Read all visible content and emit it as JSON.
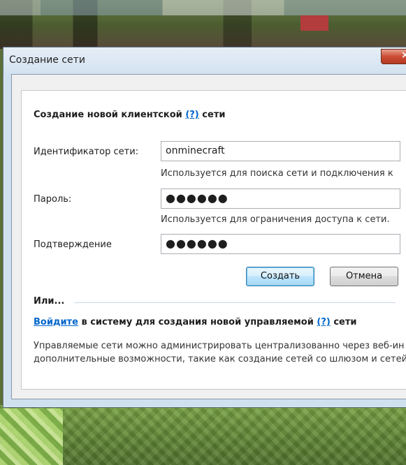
{
  "window": {
    "title": "Создание сети",
    "close_glyph": "×"
  },
  "form": {
    "heading_prefix": "Создание новой клиентской",
    "help_link": "(?)",
    "heading_suffix": "сети",
    "network_id": {
      "label": "Идентификатор сети:",
      "value": "onminecraft",
      "hint": "Используется для поиска сети и подключения к"
    },
    "password": {
      "label": "Пароль:",
      "value": "●●●●●●",
      "hint": "Используется для ограничения доступа к сети."
    },
    "confirm": {
      "label": "Подтверждение",
      "value": "●●●●●●"
    },
    "create_button": "Создать",
    "cancel_button": "Отмена"
  },
  "alternative": {
    "or_label": "Или...",
    "login_link": "Войдите",
    "login_text": "в систему для создания новой управляемой",
    "help_link": "(?)",
    "login_suffix": "сети",
    "description_line1": "Управляемые сети можно администрировать централизованно через веб-ин",
    "description_line2": "дополнительные возможности, такие как создание сетей со шлюзом и сетей"
  },
  "icons": {
    "close": "close-icon"
  },
  "colors": {
    "link": "#0066cc",
    "close_button": "#cc4d34",
    "titlebar": "#d3e2f0"
  }
}
